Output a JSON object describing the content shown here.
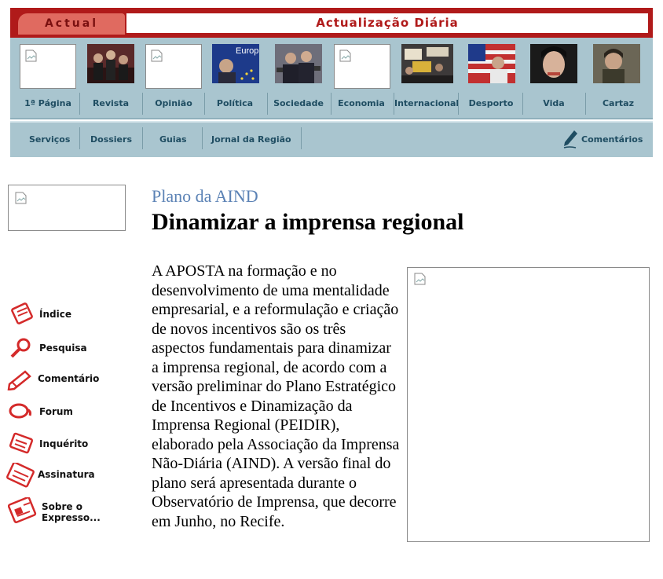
{
  "header": {
    "tab_label": "Actual",
    "title": "Actualização Diária"
  },
  "main_nav": [
    {
      "label": "1ª Página",
      "thumb": "broken-image"
    },
    {
      "label": "Revista",
      "thumb": "photo-group"
    },
    {
      "label": "Opinião",
      "thumb": "broken-image"
    },
    {
      "label": "Política",
      "thumb": "photo-europe"
    },
    {
      "label": "Sociedade",
      "thumb": "photo-press"
    },
    {
      "label": "Economia",
      "thumb": "broken-image"
    },
    {
      "label": "Internacional",
      "thumb": "photo-protest"
    },
    {
      "label": "Desporto",
      "thumb": "photo-flag"
    },
    {
      "label": "Vida",
      "thumb": "photo-portrait"
    },
    {
      "label": "Cartaz",
      "thumb": "photo-actor"
    }
  ],
  "europe_thumb_text": "Europ",
  "sub_nav": {
    "items": [
      "Serviços",
      "Dossiers",
      "Guias",
      "Jornal da Região"
    ],
    "comments": "Comentários"
  },
  "sidebar": [
    {
      "label": "Índice",
      "icon": "index-icon"
    },
    {
      "label": "Pesquisa",
      "icon": "search-icon"
    },
    {
      "label": "Comentário",
      "icon": "pencil-icon"
    },
    {
      "label": "Forum",
      "icon": "forum-icon"
    },
    {
      "label": "Inquérito",
      "icon": "survey-icon"
    },
    {
      "label": "Assinatura",
      "icon": "subscription-icon"
    },
    {
      "label_line1": "Sobre o",
      "label_line2": "Expresso...",
      "icon": "about-icon"
    }
  ],
  "article": {
    "kicker": "Plano da AIND",
    "headline": "Dinamizar a imprensa regional",
    "body": "A APOSTA na formação e no desenvolvimento de uma mentalidade empresarial, e a reformulação e criação de novos incentivos são os três aspectos fundamentais para dinamizar a imprensa regional, de acordo com a versão preliminar do Plano Estratégico de Incentivos e Dinamização da Imprensa Regional (PEIDIR), elaborado pela Associação da Imprensa Não-Diária (AIND). A versão final do plano será apresentada durante o Observatório de Imprensa, que decorre em Junho, no Recife."
  },
  "colors": {
    "banner_red": "#b01a1a",
    "tab_red": "#e06a60",
    "panel_blue": "#a9c5cf",
    "nav_text": "#1f4d62",
    "kicker_blue": "#5b82b5",
    "icon_red": "#d42a2a"
  }
}
